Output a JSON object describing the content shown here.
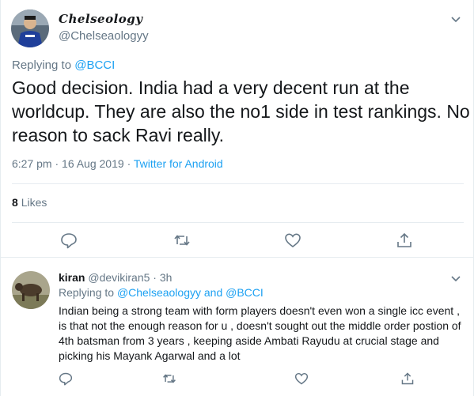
{
  "main_tweet": {
    "display_name": "Chelseology",
    "handle": "@Chelseaologyy",
    "replying_prefix": "Replying to",
    "replying_to": "@BCCI",
    "text": "Good decision. India had a very decent run at the worldcup. They are also the no1 side in test rankings. No reason to sack Ravi really.",
    "timestamp": "6:27 pm · 16 Aug 2019",
    "separator": "·",
    "client": "Twitter for Android",
    "likes_count": "8",
    "likes_label": "Likes"
  },
  "reply_tweet": {
    "display_name": "kiran",
    "handle": "@devikiran5",
    "separator": "·",
    "time": "3h",
    "replying_prefix": "Replying to",
    "replying_to_1": "@Chelseaologyy",
    "replying_and": "and",
    "replying_to_2": "@BCCI",
    "text": "Indian being a strong team with form players doesn't even won a single icc event , is that not the enough reason for u , doesn't sought out the middle order postion of 4th batsman from 3 years , keeping aside Ambati Rayudu at crucial stage and picking his Mayank Agarwal and a lot"
  },
  "icons": {
    "reply": "reply-icon",
    "retweet": "retweet-icon",
    "like": "heart-icon",
    "share": "share-icon",
    "caret": "chevron-down-icon"
  },
  "colors": {
    "link": "#1da1f2",
    "secondary_text": "#657786",
    "primary_text": "#14171a",
    "divider": "#e6ecf0"
  }
}
